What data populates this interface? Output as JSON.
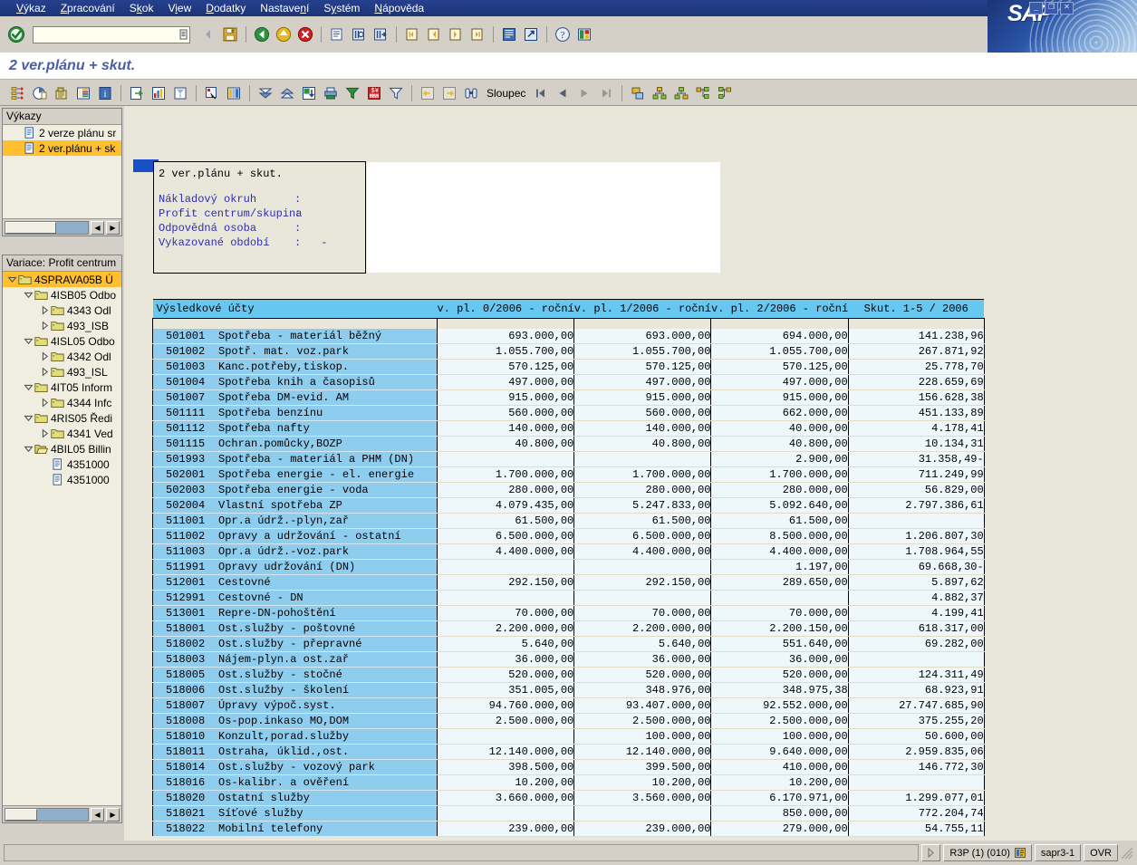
{
  "window": {
    "app_name": "SAP",
    "buttons": [
      "minimize",
      "maximize",
      "close"
    ]
  },
  "menubar": {
    "items": [
      {
        "label": "Výkaz",
        "accel": "V"
      },
      {
        "label": "Zpracování",
        "accel": "Z"
      },
      {
        "label": "Skok",
        "accel": "k"
      },
      {
        "label": "View",
        "accel": "i"
      },
      {
        "label": "Dodatky",
        "accel": "D"
      },
      {
        "label": "Nastavení",
        "accel": "n"
      },
      {
        "label": "Systém",
        "accel": "y"
      },
      {
        "label": "Nápověda",
        "accel": "N"
      }
    ]
  },
  "command_field": {
    "value": "",
    "placeholder": ""
  },
  "system_toolbar": {
    "buttons": [
      "enter-check-icon",
      "save-icon",
      "back-green-icon",
      "exit-yellow-icon",
      "cancel-red-icon",
      "print-icon",
      "find-icon",
      "find-next-icon",
      "first-page-icon",
      "previous-page-icon",
      "next-page-icon",
      "last-page-icon",
      "new-session-icon",
      "create-shortcut-icon",
      "help-icon",
      "customize-local-layout-icon"
    ]
  },
  "program_title": "2 ver.plánu + skut.",
  "app_toolbar": {
    "buttons": [
      "navigation-icon",
      "report-overview-icon",
      "variation-icon",
      "detail-list-icon",
      "info-icon",
      "export-icon",
      "graphics-icon",
      "print-preview-icon",
      "select-pointer-icon",
      "columns-icon",
      "sort-descending-icon",
      "sort-ascending-icon",
      "download-icon",
      "print-list-icon",
      "filter-funnel-icon",
      "currency-icon",
      "filter-icon",
      "previous-report-icon",
      "next-report-icon",
      "binoculars-icon"
    ],
    "column_button_label": "Sloupec",
    "nav_buttons": [
      "first-icon",
      "previous-icon",
      "next-icon",
      "last-icon"
    ],
    "hierarchy_buttons": [
      "expand-node-icon",
      "hierarchy-up-icon",
      "hierarchy-down-icon",
      "expand-subtree-icon",
      "collapse-subtree-icon"
    ]
  },
  "sidebar": {
    "reports_panel": {
      "header": "Výkazy",
      "items": [
        {
          "label": "2 verze plánu sr",
          "icon": "document-icon",
          "selected": false
        },
        {
          "label": "2 ver.plánu + sk",
          "icon": "document-icon",
          "selected": true
        }
      ],
      "scroll_left_label": "◀",
      "scroll_right_label": "▶"
    },
    "variation_panel": {
      "header": "Variace: Profit centrum",
      "nodes": [
        {
          "label": "4SPRAVA05B Ú",
          "indent": 0,
          "twist": "expanded",
          "icon": "folder-icon",
          "selected": true
        },
        {
          "label": "4ISB05 Odbo",
          "indent": 1,
          "twist": "expanded",
          "icon": "folder-icon",
          "selected": false
        },
        {
          "label": "4343 Odl",
          "indent": 2,
          "twist": "collapsed",
          "icon": "folder-icon",
          "selected": false
        },
        {
          "label": "493_ISB",
          "indent": 2,
          "twist": "collapsed",
          "icon": "folder-icon",
          "selected": false
        },
        {
          "label": "4ISL05 Odbo",
          "indent": 1,
          "twist": "expanded",
          "icon": "folder-icon",
          "selected": false
        },
        {
          "label": "4342 Odl",
          "indent": 2,
          "twist": "collapsed",
          "icon": "folder-icon",
          "selected": false
        },
        {
          "label": "493_ISL",
          "indent": 2,
          "twist": "collapsed",
          "icon": "folder-icon",
          "selected": false
        },
        {
          "label": "4IT05 Inform",
          "indent": 1,
          "twist": "expanded",
          "icon": "folder-icon",
          "selected": false
        },
        {
          "label": "4344 Infc",
          "indent": 2,
          "twist": "collapsed",
          "icon": "folder-icon",
          "selected": false
        },
        {
          "label": "4RIS05 Ředi",
          "indent": 1,
          "twist": "expanded",
          "icon": "folder-icon",
          "selected": false
        },
        {
          "label": "4341 Ved",
          "indent": 2,
          "twist": "collapsed",
          "icon": "folder-icon",
          "selected": false
        },
        {
          "label": "4BIL05 Billin",
          "indent": 1,
          "twist": "expanded",
          "icon": "folder-open-icon",
          "selected": false
        },
        {
          "label": "4351000",
          "indent": 2,
          "twist": "none",
          "icon": "document-icon",
          "selected": false
        },
        {
          "label": "4351000",
          "indent": 2,
          "twist": "none",
          "icon": "document-icon",
          "selected": false
        }
      ],
      "scroll_left_label": "◀",
      "scroll_right_label": "▶"
    }
  },
  "report_header": {
    "title": "2 ver.plánu + skut.",
    "fields": [
      {
        "key": "Nákladový okruh",
        "colon": ":",
        "value": ""
      },
      {
        "key": "Profit centrum/skupina",
        "colon": ":",
        "value": ""
      },
      {
        "key": "Odpovědná osoba",
        "colon": ":",
        "value": ""
      },
      {
        "key": "Vykazované období",
        "colon": ":",
        "value": "-"
      }
    ]
  },
  "chart_data": {
    "type": "table",
    "title": "2 ver.plánu + skut.",
    "columns": [
      "Výsledkové účty",
      "v. pl. 0/2006 - roční",
      "v. pl. 1/2006 - roční",
      "v. pl. 2/2006 - roční",
      "Skut. 1-5 / 2006"
    ],
    "rows": [
      {
        "account": "501001",
        "description": "Spotřeba - materiál běžný",
        "v0": "693.000,00",
        "v1": "693.000,00",
        "v2": "694.000,00",
        "actual": "141.238,96"
      },
      {
        "account": "501002",
        "description": "Spotř. mat. voz.park",
        "v0": "1.055.700,00",
        "v1": "1.055.700,00",
        "v2": "1.055.700,00",
        "actual": "267.871,92"
      },
      {
        "account": "501003",
        "description": "Kanc.potřeby,tiskop.",
        "v0": "570.125,00",
        "v1": "570.125,00",
        "v2": "570.125,00",
        "actual": "25.778,70"
      },
      {
        "account": "501004",
        "description": "Spotřeba knih a časopisů",
        "v0": "497.000,00",
        "v1": "497.000,00",
        "v2": "497.000,00",
        "actual": "228.659,69"
      },
      {
        "account": "501007",
        "description": "Spotřeba DM-evid. AM",
        "v0": "915.000,00",
        "v1": "915.000,00",
        "v2": "915.000,00",
        "actual": "156.628,38"
      },
      {
        "account": "501111",
        "description": "Spotřeba benzínu",
        "v0": "560.000,00",
        "v1": "560.000,00",
        "v2": "662.000,00",
        "actual": "451.133,89"
      },
      {
        "account": "501112",
        "description": "Spotřeba nafty",
        "v0": "140.000,00",
        "v1": "140.000,00",
        "v2": "40.000,00",
        "actual": "4.178,41"
      },
      {
        "account": "501115",
        "description": "Ochran.pomůcky,BOZP",
        "v0": "40.800,00",
        "v1": "40.800,00",
        "v2": "40.800,00",
        "actual": "10.134,31"
      },
      {
        "account": "501993",
        "description": "Spotřeba - materiál a PHM (DN)",
        "v0": "",
        "v1": "",
        "v2": "2.900,00",
        "actual": "31.358,49-"
      },
      {
        "account": "502001",
        "description": "Spotřeba energie - el. energie",
        "v0": "1.700.000,00",
        "v1": "1.700.000,00",
        "v2": "1.700.000,00",
        "actual": "711.249,99"
      },
      {
        "account": "502003",
        "description": "Spotřeba energie - voda",
        "v0": "280.000,00",
        "v1": "280.000,00",
        "v2": "280.000,00",
        "actual": "56.829,00"
      },
      {
        "account": "502004",
        "description": "Vlastní spotřeba ZP",
        "v0": "4.079.435,00",
        "v1": "5.247.833,00",
        "v2": "5.092.640,00",
        "actual": "2.797.386,61"
      },
      {
        "account": "511001",
        "description": "Opr.a údrž.-plyn,zař",
        "v0": "61.500,00",
        "v1": "61.500,00",
        "v2": "61.500,00",
        "actual": ""
      },
      {
        "account": "511002",
        "description": "Opravy a udržování - ostatní",
        "v0": "6.500.000,00",
        "v1": "6.500.000,00",
        "v2": "8.500.000,00",
        "actual": "1.206.807,30"
      },
      {
        "account": "511003",
        "description": "Opr.a údrž.-voz.park",
        "v0": "4.400.000,00",
        "v1": "4.400.000,00",
        "v2": "4.400.000,00",
        "actual": "1.708.964,55"
      },
      {
        "account": "511991",
        "description": "Opravy udržování (DN)",
        "v0": "",
        "v1": "",
        "v2": "1.197,00",
        "actual": "69.668,30-"
      },
      {
        "account": "512001",
        "description": "Cestovné",
        "v0": "292.150,00",
        "v1": "292.150,00",
        "v2": "289.650,00",
        "actual": "5.897,62"
      },
      {
        "account": "512991",
        "description": "Cestovné - DN",
        "v0": "",
        "v1": "",
        "v2": "",
        "actual": "4.882,37"
      },
      {
        "account": "513001",
        "description": "Repre-DN-pohoštění",
        "v0": "70.000,00",
        "v1": "70.000,00",
        "v2": "70.000,00",
        "actual": "4.199,41"
      },
      {
        "account": "518001",
        "description": "Ost.služby - poštovné",
        "v0": "2.200.000,00",
        "v1": "2.200.000,00",
        "v2": "2.200.150,00",
        "actual": "618.317,00"
      },
      {
        "account": "518002",
        "description": "Ost.služby - přepravné",
        "v0": "5.640,00",
        "v1": "5.640,00",
        "v2": "551.640,00",
        "actual": "69.282,00"
      },
      {
        "account": "518003",
        "description": "Nájem-plyn.a ost.zař",
        "v0": "36.000,00",
        "v1": "36.000,00",
        "v2": "36.000,00",
        "actual": ""
      },
      {
        "account": "518005",
        "description": "Ost.služby - stočné",
        "v0": "520.000,00",
        "v1": "520.000,00",
        "v2": "520.000,00",
        "actual": "124.311,49"
      },
      {
        "account": "518006",
        "description": "Ost.služby - školení",
        "v0": "351.005,00",
        "v1": "348.976,00",
        "v2": "348.975,38",
        "actual": "68.923,91"
      },
      {
        "account": "518007",
        "description": "Úpravy výpoč.syst.",
        "v0": "94.760.000,00",
        "v1": "93.407.000,00",
        "v2": "92.552.000,00",
        "actual": "27.747.685,90"
      },
      {
        "account": "518008",
        "description": "Os-pop.inkaso MO,DOM",
        "v0": "2.500.000,00",
        "v1": "2.500.000,00",
        "v2": "2.500.000,00",
        "actual": "375.255,20"
      },
      {
        "account": "518010",
        "description": "Konzult,porad.služby",
        "v0": "",
        "v1": "100.000,00",
        "v2": "100.000,00",
        "actual": "50.600,00"
      },
      {
        "account": "518011",
        "description": "Ostraha, úklid.,ost.",
        "v0": "12.140.000,00",
        "v1": "12.140.000,00",
        "v2": "9.640.000,00",
        "actual": "2.959.835,06"
      },
      {
        "account": "518014",
        "description": "Ost.služby - vozový park",
        "v0": "398.500,00",
        "v1": "399.500,00",
        "v2": "410.000,00",
        "actual": "146.772,30"
      },
      {
        "account": "518016",
        "description": "Os-kalibr. a ověření",
        "v0": "10.200,00",
        "v1": "10.200,00",
        "v2": "10.200,00",
        "actual": ""
      },
      {
        "account": "518020",
        "description": "Ostatní služby",
        "v0": "3.660.000,00",
        "v1": "3.560.000,00",
        "v2": "6.170.971,00",
        "actual": "1.299.077,01"
      },
      {
        "account": "518021",
        "description": "Síťové služby",
        "v0": "",
        "v1": "",
        "v2": "850.000,00",
        "actual": "772.204,74"
      },
      {
        "account": "518022",
        "description": "Mobilní telefony",
        "v0": "239.000,00",
        "v1": "239.000,00",
        "v2": "279.000,00",
        "actual": "54.755,11"
      }
    ]
  },
  "statusbar": {
    "message": "",
    "system": "R3P (1) (010)",
    "server": "sapr3-1",
    "mode": "OVR",
    "expand_icon": "expand-arrow-icon",
    "servicon": "status-menu-icon"
  },
  "colors": {
    "titlebar_blue": "#1b3477",
    "toolbar_gray": "#d4d0c8",
    "header_cyan": "#66c8f0",
    "row_blue": "#8fcdee",
    "num_bg": "#eef7fc",
    "selection_orange": "#ffbf2e",
    "title_text": "#4a5fa5",
    "report_label_blue": "#2e2eb0"
  }
}
